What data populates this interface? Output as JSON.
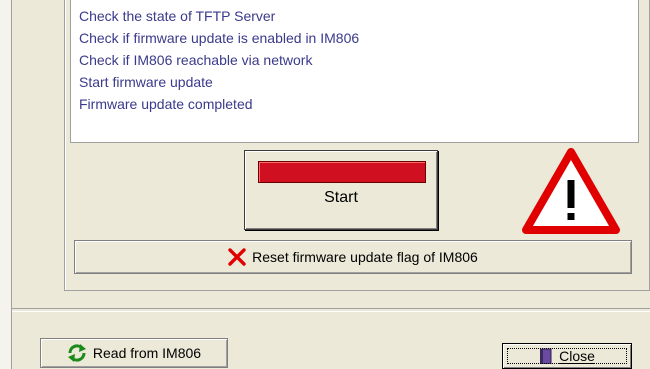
{
  "log": {
    "lines": [
      "Check the state of TFTP Server",
      "Check if firmware update is enabled in IM806",
      "Check if IM806 reachable via network",
      "Start firmware update",
      "Firmware update completed"
    ]
  },
  "start_button": {
    "label": "Start",
    "indicator_color": "#d01020"
  },
  "warning": {
    "icon": "warning-triangle-icon",
    "color": "#e00000"
  },
  "reset_button": {
    "label": "Reset firmware update flag of IM806",
    "icon": "red-x-icon"
  },
  "read_button": {
    "label": "Read from IM806",
    "icon": "refresh-icon"
  },
  "close_button": {
    "label": "Close",
    "icon": "door-icon"
  }
}
